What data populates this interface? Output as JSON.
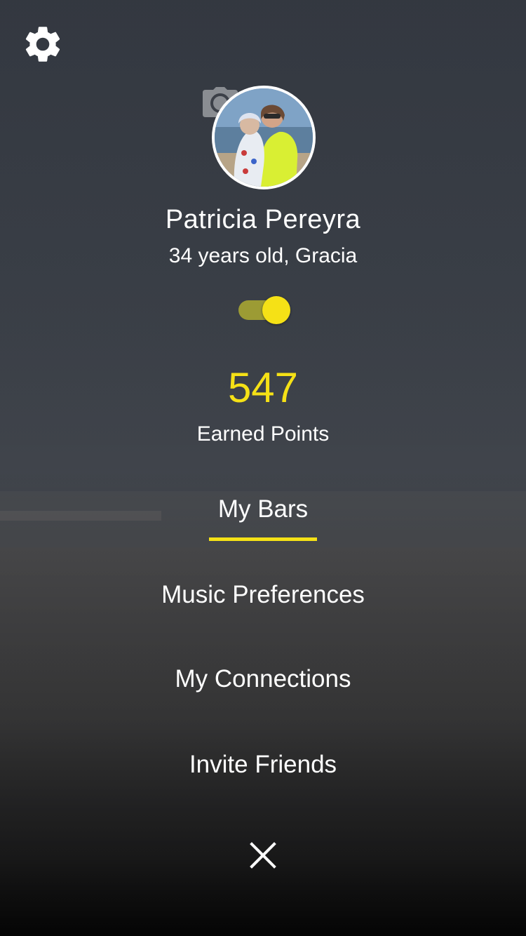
{
  "profile": {
    "name": "Patricia Pereyra",
    "subtitle": "34 years old, Gracia",
    "avatar_alt": "Profile photo",
    "visibility_toggle_on": true
  },
  "points": {
    "value": "547",
    "label": "Earned Points"
  },
  "menu": {
    "items": [
      {
        "label": "My Bars",
        "active": true
      },
      {
        "label": "Music Preferences",
        "active": false
      },
      {
        "label": "My Connections",
        "active": false
      },
      {
        "label": "Invite Friends",
        "active": false
      }
    ]
  },
  "icons": {
    "settings": "gear-icon",
    "camera": "camera-icon",
    "close": "close-icon"
  },
  "colors": {
    "accent": "#f5e116",
    "toggle_track": "#9c9b34",
    "text": "#ffffff"
  }
}
